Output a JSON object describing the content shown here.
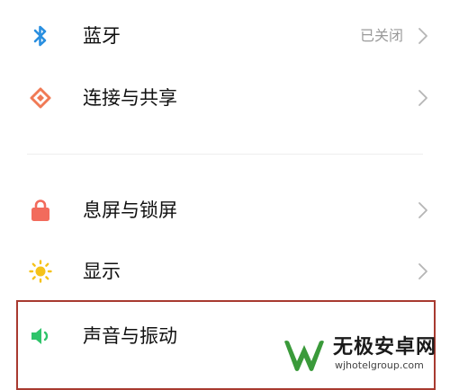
{
  "settings": {
    "bluetooth": {
      "label": "蓝牙",
      "value": "已关闭"
    },
    "connection": {
      "label": "连接与共享"
    },
    "lockscreen": {
      "label": "息屏与锁屏"
    },
    "display": {
      "label": "显示"
    },
    "sound": {
      "label": "声音与振动"
    }
  },
  "watermark": {
    "name": "无极安卓网",
    "url": "wjhotelgroup.com"
  },
  "colors": {
    "bluetooth_icon": "#2a8fe0",
    "connection_icon": "#f07a55",
    "lock_icon": "#f26b5c",
    "display_icon": "#f5c21a",
    "sound_icon": "#2fc46a",
    "highlight_border": "#a83a30",
    "watermark_green": "#3a9a3a"
  }
}
